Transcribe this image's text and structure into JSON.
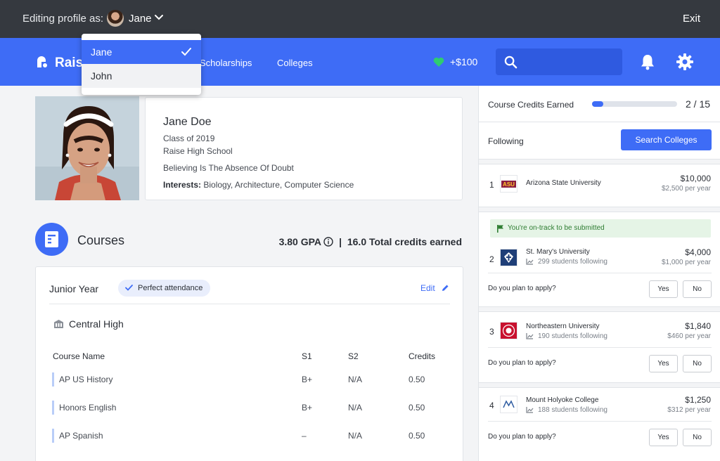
{
  "editbar": {
    "label": "Editing profile as:",
    "current_user": "Jane",
    "exit_label": "Exit"
  },
  "dropdown": {
    "options": [
      {
        "label": "Jane",
        "selected": true
      },
      {
        "label": "John",
        "selected": false
      }
    ]
  },
  "nav": {
    "logo_text": "Raise",
    "links": [
      "Scholarships",
      "Colleges"
    ],
    "credits": "+$100",
    "search_placeholder": "",
    "icons": [
      "heart-icon",
      "search-icon",
      "bell-icon",
      "gear-icon"
    ]
  },
  "profile": {
    "name": "Jane Doe",
    "class_of": "Class of 2019",
    "school": "Raise High School",
    "motto": "Believing Is The Absence Of Doubt",
    "interests_label": "Interests:",
    "interests": "Biology, Architecture, Computer Science"
  },
  "courses": {
    "title": "Courses",
    "gpa": "3.80 GPA",
    "separator": "|",
    "total_credits": "16.0 Total credits earned",
    "year": {
      "title": "Junior Year",
      "badge": "Perfect attendance",
      "edit_label": "Edit",
      "school": "Central High",
      "columns": [
        "Course Name",
        "S1",
        "S2",
        "Credits"
      ],
      "rows": [
        [
          "AP US History",
          "B+",
          "N/A",
          "0.50"
        ],
        [
          "Honors English",
          "B+",
          "N/A",
          "0.50"
        ],
        [
          "AP Spanish",
          "–",
          "N/A",
          "0.50"
        ]
      ]
    }
  },
  "sidebar": {
    "credits_label": "Course Credits Earned",
    "credits_progress": {
      "earned": 2,
      "total": 15
    },
    "credits_count": "2 / 15",
    "following_label": "Following",
    "search_button": "Search Colleges",
    "ontrack_label": "You're on-track to be submitted",
    "plan_label": "Do you plan to apply?",
    "yes_label": "Yes",
    "no_label": "No",
    "colleges": [
      {
        "rank": "1",
        "name": "Arizona State University",
        "amount": "$10,000",
        "per_year": "$2,500 per year"
      },
      {
        "rank": "2",
        "name": "St. Mary's University",
        "followers": "299 students following",
        "amount": "$4,000",
        "per_year": "$1,000 per year"
      },
      {
        "rank": "3",
        "name": "Northeastern University",
        "followers": "190 students following",
        "amount": "$1,840",
        "per_year": "$460 per year"
      },
      {
        "rank": "4",
        "name": "Mount Holyoke College",
        "followers": "188 students following",
        "amount": "$1,250",
        "per_year": "$312 per year"
      }
    ]
  },
  "colors": {
    "primary": "#3e6cf6",
    "topbar": "#35393f",
    "success_bg": "#e5f4e6",
    "success_text": "#2e7d32",
    "heart": "#2ecc71"
  }
}
